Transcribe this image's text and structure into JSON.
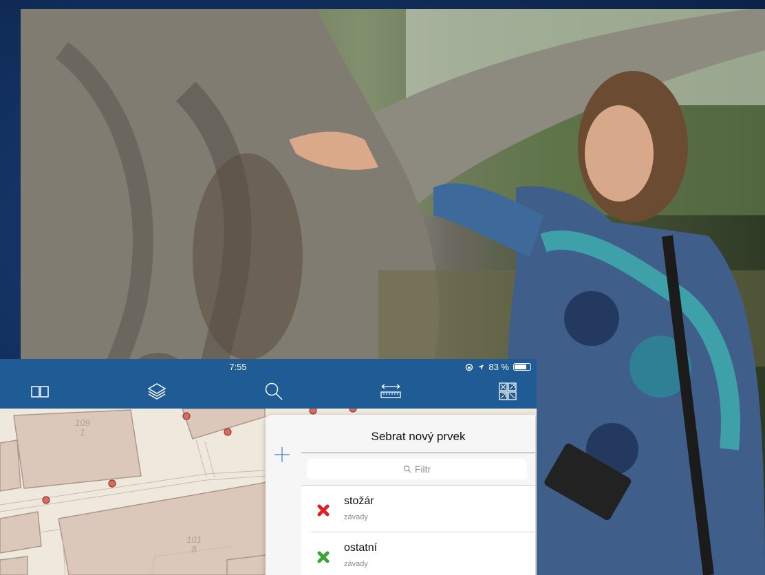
{
  "statusbar": {
    "time": "7:55",
    "battery_text": "83 %",
    "battery_level": 0.83
  },
  "toolbar": {
    "icons": [
      "book-icon",
      "layers-icon",
      "search-icon",
      "measure-icon",
      "map-extent-icon"
    ]
  },
  "map": {
    "parcel_labels": [
      {
        "number": "109",
        "sub": "1"
      },
      {
        "number": "101",
        "sub": "8"
      }
    ]
  },
  "panel": {
    "title": "Sebrat nový prvek",
    "filter_placeholder": "Filtr",
    "items": [
      {
        "label": "stožár",
        "category": "závady",
        "marker_color": "#e02020"
      },
      {
        "label": "ostatní",
        "category": "závady",
        "marker_color": "#3aa535"
      }
    ]
  },
  "colors": {
    "toolbar": "#1f5b94",
    "background": "#0f2a55"
  }
}
